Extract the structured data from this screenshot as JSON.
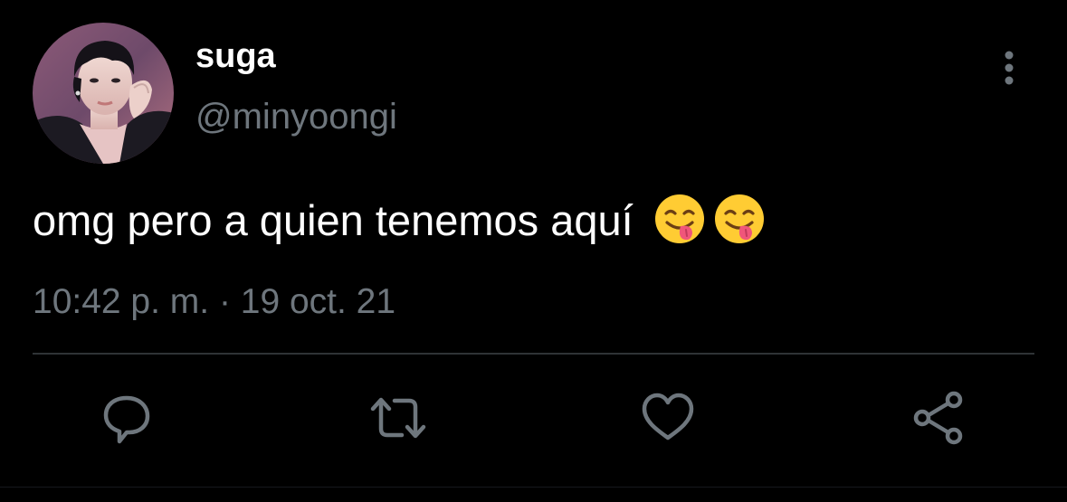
{
  "tweet": {
    "display_name": "suga",
    "handle": "@minyoongi",
    "text": "omg pero a quien tenemos aquí",
    "emojis": [
      "face-savoring-food-emoji",
      "face-savoring-food-emoji"
    ],
    "timestamp": "10:42 p. m. · 19 oct. 21"
  },
  "actions": {
    "icons": [
      "reply-icon",
      "retweet-icon",
      "like-icon",
      "share-icon"
    ]
  },
  "colors": {
    "background": "#000000",
    "primary_text": "#ffffff",
    "secondary_text": "#6e767d",
    "divider": "#2f3336",
    "emoji_face": "#ffcc33",
    "emoji_tongue": "#f0567a"
  }
}
